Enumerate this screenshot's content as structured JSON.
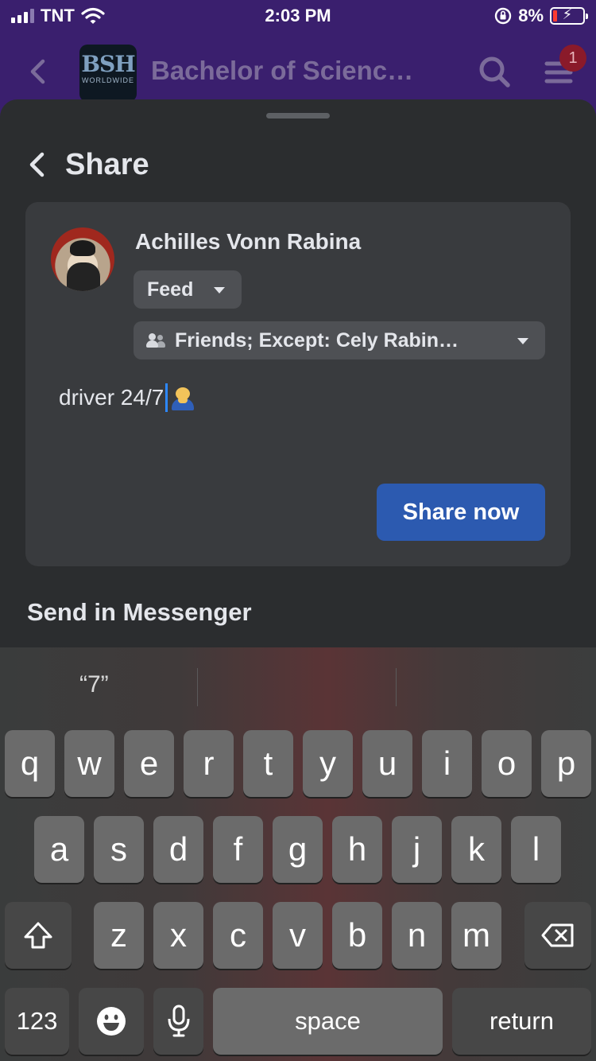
{
  "status_bar": {
    "carrier": "TNT",
    "time": "2:03 PM",
    "battery_percent": "8%",
    "signal_bars_active": 3,
    "icons": [
      "signal-icon",
      "wifi-icon",
      "orientation-lock-icon",
      "battery-charging-icon"
    ]
  },
  "group_header": {
    "title": "Bachelor of Scienc…",
    "logo_text": "BSH",
    "logo_subtext": "WORLDWIDE",
    "notification_count": "1",
    "icons": [
      "back-chevron-icon",
      "search-icon",
      "menu-icon"
    ]
  },
  "share_sheet": {
    "title": "Share",
    "user_name": "Achilles Vonn Rabina",
    "destination": "Feed",
    "audience": "Friends; Except: Cely Rabin…",
    "post_text": "driver 24/7",
    "share_button": "Share now",
    "messenger_heading": "Send in Messenger",
    "colors": {
      "share_button": "#2c5ab0",
      "card": "#393b3e",
      "sheet": "#2b2d2f",
      "header": "#3a1f6e"
    }
  },
  "keyboard": {
    "suggestion": "“7”",
    "row1": [
      "q",
      "w",
      "e",
      "r",
      "t",
      "y",
      "u",
      "i",
      "o",
      "p"
    ],
    "row2": [
      "a",
      "s",
      "d",
      "f",
      "g",
      "h",
      "j",
      "k",
      "l"
    ],
    "row3": [
      "z",
      "x",
      "c",
      "v",
      "b",
      "n",
      "m"
    ],
    "numbers_key": "123",
    "space_key": "space",
    "return_key": "return",
    "icons": [
      "shift-icon",
      "backspace-icon",
      "emoji-icon",
      "microphone-icon"
    ]
  }
}
